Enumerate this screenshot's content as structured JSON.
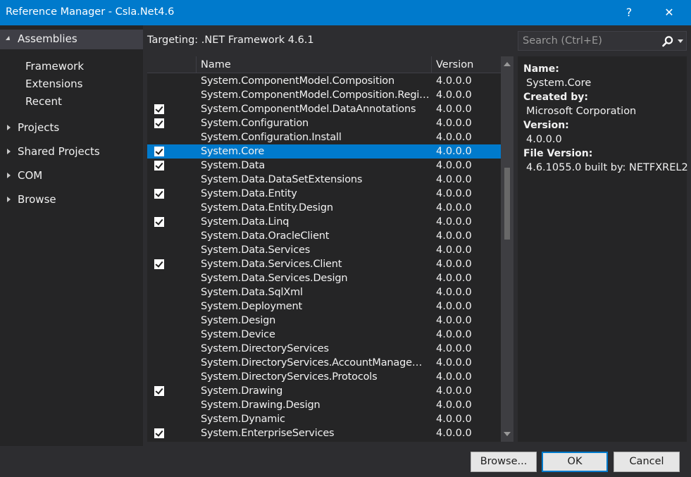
{
  "window": {
    "title": "Reference Manager - Csla.Net4.6",
    "help_label": "?",
    "close_label": "✕"
  },
  "nav": {
    "assemblies_label": "Assemblies",
    "sub_items": [
      "Framework",
      "Extensions",
      "Recent"
    ],
    "items": [
      "Projects",
      "Shared Projects",
      "COM",
      "Browse"
    ]
  },
  "targeting": "Targeting: .NET Framework 4.6.1",
  "search": {
    "placeholder": "Search (Ctrl+E)"
  },
  "grid": {
    "columns": {
      "name": "Name",
      "version": "Version"
    },
    "rows": [
      {
        "name": "System.ComponentModel.Composition",
        "version": "4.0.0.0",
        "checked": false,
        "selected": false
      },
      {
        "name": "System.ComponentModel.Composition.Registration",
        "version": "4.0.0.0",
        "checked": false,
        "selected": false
      },
      {
        "name": "System.ComponentModel.DataAnnotations",
        "version": "4.0.0.0",
        "checked": true,
        "selected": false
      },
      {
        "name": "System.Configuration",
        "version": "4.0.0.0",
        "checked": true,
        "selected": false
      },
      {
        "name": "System.Configuration.Install",
        "version": "4.0.0.0",
        "checked": false,
        "selected": false
      },
      {
        "name": "System.Core",
        "version": "4.0.0.0",
        "checked": true,
        "selected": true
      },
      {
        "name": "System.Data",
        "version": "4.0.0.0",
        "checked": true,
        "selected": false
      },
      {
        "name": "System.Data.DataSetExtensions",
        "version": "4.0.0.0",
        "checked": false,
        "selected": false
      },
      {
        "name": "System.Data.Entity",
        "version": "4.0.0.0",
        "checked": true,
        "selected": false
      },
      {
        "name": "System.Data.Entity.Design",
        "version": "4.0.0.0",
        "checked": false,
        "selected": false
      },
      {
        "name": "System.Data.Linq",
        "version": "4.0.0.0",
        "checked": true,
        "selected": false
      },
      {
        "name": "System.Data.OracleClient",
        "version": "4.0.0.0",
        "checked": false,
        "selected": false
      },
      {
        "name": "System.Data.Services",
        "version": "4.0.0.0",
        "checked": false,
        "selected": false
      },
      {
        "name": "System.Data.Services.Client",
        "version": "4.0.0.0",
        "checked": true,
        "selected": false
      },
      {
        "name": "System.Data.Services.Design",
        "version": "4.0.0.0",
        "checked": false,
        "selected": false
      },
      {
        "name": "System.Data.SqlXml",
        "version": "4.0.0.0",
        "checked": false,
        "selected": false
      },
      {
        "name": "System.Deployment",
        "version": "4.0.0.0",
        "checked": false,
        "selected": false
      },
      {
        "name": "System.Design",
        "version": "4.0.0.0",
        "checked": false,
        "selected": false
      },
      {
        "name": "System.Device",
        "version": "4.0.0.0",
        "checked": false,
        "selected": false
      },
      {
        "name": "System.DirectoryServices",
        "version": "4.0.0.0",
        "checked": false,
        "selected": false
      },
      {
        "name": "System.DirectoryServices.AccountManagement",
        "version": "4.0.0.0",
        "checked": false,
        "selected": false
      },
      {
        "name": "System.DirectoryServices.Protocols",
        "version": "4.0.0.0",
        "checked": false,
        "selected": false
      },
      {
        "name": "System.Drawing",
        "version": "4.0.0.0",
        "checked": true,
        "selected": false
      },
      {
        "name": "System.Drawing.Design",
        "version": "4.0.0.0",
        "checked": false,
        "selected": false
      },
      {
        "name": "System.Dynamic",
        "version": "4.0.0.0",
        "checked": false,
        "selected": false
      },
      {
        "name": "System.EnterpriseServices",
        "version": "4.0.0.0",
        "checked": true,
        "selected": false
      }
    ]
  },
  "details": {
    "name_label": "Name:",
    "name_value": "System.Core",
    "created_label": "Created by:",
    "created_value": "Microsoft Corporation",
    "version_label": "Version:",
    "version_value": "4.0.0.0",
    "file_version_label": "File Version:",
    "file_version_value": "4.6.1055.0 built by: NETFXREL2"
  },
  "buttons": {
    "browse": "Browse...",
    "ok": "OK",
    "cancel": "Cancel"
  },
  "colors": {
    "accent": "#007acc",
    "background": "#2d2d30",
    "panel": "#252526"
  }
}
